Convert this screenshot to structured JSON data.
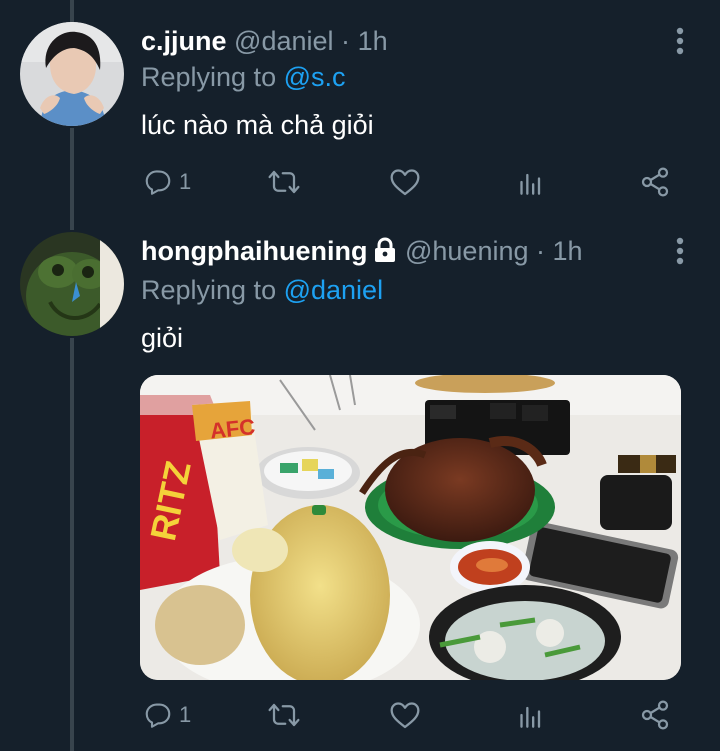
{
  "tweets": [
    {
      "display_name": "c.jjune",
      "handle": "@daniel",
      "separator": "·",
      "time": "1h",
      "replying_prefix": "Replying to ",
      "replying_to": "@s.c",
      "text": "lúc nào mà chả giỏi",
      "reply_count": "1",
      "locked": false
    },
    {
      "display_name": "hongphaihuening",
      "handle": "@huening",
      "separator": "·",
      "time": "1h",
      "replying_prefix": "Replying to ",
      "replying_to": "@daniel",
      "text": "giỏi",
      "reply_count": "1",
      "locked": true
    }
  ],
  "media_packaging": {
    "ritz": "RITZ",
    "afc": "AFC"
  },
  "icons": {
    "reply": "reply-icon",
    "retweet": "retweet-icon",
    "like": "heart-icon",
    "analytics": "analytics-icon",
    "share": "share-icon",
    "more": "more-vertical-icon",
    "lock": "lock-icon"
  },
  "colors": {
    "background": "#15202b",
    "text_primary": "#ffffff",
    "text_secondary": "#8899a6",
    "link": "#1da1f2",
    "thread_line": "#38444d"
  }
}
